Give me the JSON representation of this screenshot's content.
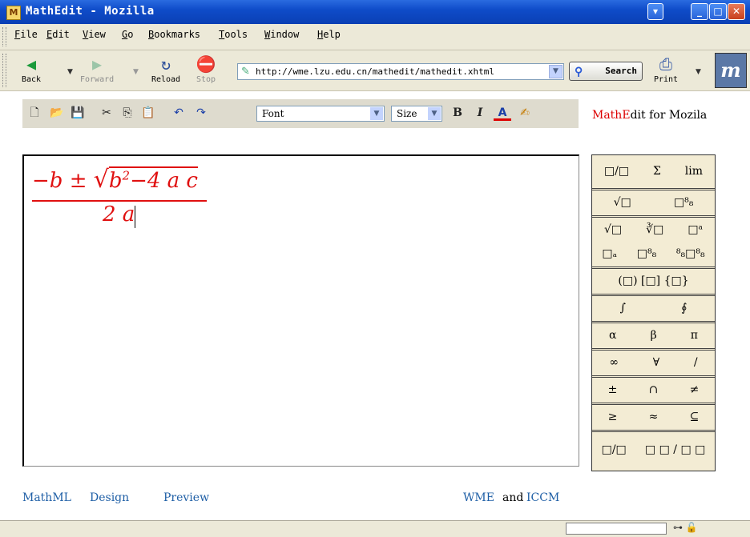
{
  "window": {
    "title": "MathEdit - Mozilla",
    "app_icon": "mozilla-app-icon",
    "controls": {
      "minimize": "_",
      "maximize": "□",
      "close": "✕"
    }
  },
  "menu": [
    "File",
    "Edit",
    "View",
    "Go",
    "Bookmarks",
    "Tools",
    "Window",
    "Help"
  ],
  "nav": {
    "back": "Back",
    "forward": "Forward",
    "reload": "Reload",
    "stop": "Stop",
    "url": "http://wme.lzu.edu.cn/mathedit/mathedit.xhtml",
    "search": "Search",
    "print": "Print",
    "throbber": "m"
  },
  "editor_toolbar": {
    "font_select": "Font",
    "size_select": "Size",
    "bold": "B",
    "italic": "I",
    "font_color": "A"
  },
  "brand": {
    "math": "Math",
    "e": "E",
    "rest": "dit for Mozila"
  },
  "formula": {
    "numerator_prefix": "−b ± ",
    "radical": "√",
    "b": "b",
    "exp": "2",
    "rest": "−4 a c",
    "denominator": "2 a"
  },
  "palette": [
    [
      "□/□",
      "Σ",
      "lim"
    ],
    [
      "√□",
      "□⁸₈"
    ],
    [
      "√□",
      "∛□",
      "□ᵃ"
    ],
    [
      "□ₐ",
      "□⁸₈",
      "⁸₈□⁸₈"
    ],
    [
      "(□) [□] {□}"
    ],
    [
      "∫",
      "∮"
    ],
    [
      "α",
      "β",
      "π"
    ],
    [
      "∞",
      "∀",
      "/"
    ],
    [
      "±",
      "∩",
      "≠"
    ],
    [
      "≥",
      "≈",
      "⊆"
    ],
    [
      "□/□",
      "□ □ / □ □"
    ]
  ],
  "footer": {
    "mathml": "MathML",
    "design": "Design",
    "preview": "Preview",
    "wme": "WME",
    "and": "and",
    "iccm": "ICCM"
  }
}
